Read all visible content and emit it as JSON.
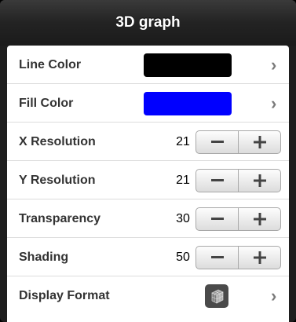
{
  "title": "3D graph",
  "rows": [
    {
      "label": "Line Color",
      "swatch_color": "#000000"
    },
    {
      "label": "Fill Color",
      "swatch_color": "#0000ff"
    },
    {
      "label": "X Resolution",
      "value": "21"
    },
    {
      "label": "Y Resolution",
      "value": "21"
    },
    {
      "label": "Transparency",
      "value": "30"
    },
    {
      "label": "Shading",
      "value": "50"
    },
    {
      "label": "Display Format",
      "icon": "wireframe-surface-icon"
    }
  ],
  "icons": {
    "chevron": "›",
    "minus": "minus-icon",
    "plus": "plus-icon"
  }
}
